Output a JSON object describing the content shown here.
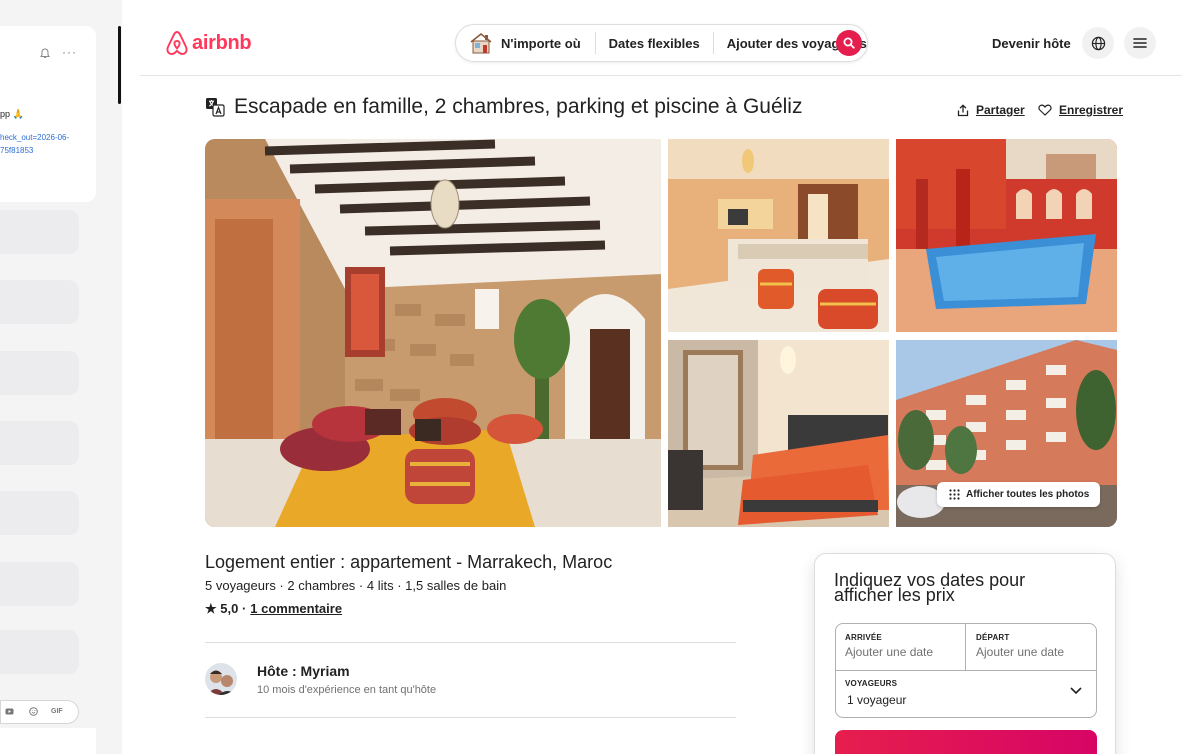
{
  "chat_panel": {
    "app_text": "pp 🙏",
    "link_line1": "heck_out=2026-06-",
    "link_line2": "75f81853",
    "gif_label": "GIF"
  },
  "header": {
    "logo": "airbnb",
    "search": {
      "anywhere": "N'importe où",
      "dates": "Dates flexibles",
      "guests": "Ajouter des voyageurs"
    },
    "become_host": "Devenir hôte"
  },
  "listing": {
    "title": "Escapade en famille, 2 chambres, parking et piscine à Guéliz",
    "share": "Partager",
    "save": "Enregistrer",
    "show_all_photos": "Afficher toutes les photos",
    "type": "Logement entier : appartement - Marrakech, Maroc",
    "details": "5 voyageurs · 2 chambres · 4 lits · 1,5 salles de bain",
    "rating_value": "★ 5,0 ·",
    "review_link": "1 commentaire",
    "host_name": "Hôte : Myriam",
    "host_experience": "10 mois d'expérience en tant qu'hôte"
  },
  "booking": {
    "heading": "Indiquez vos dates pour afficher les prix",
    "checkin_label": "ARRIVÉE",
    "checkin_placeholder": "Ajouter une date",
    "checkout_label": "DÉPART",
    "checkout_placeholder": "Ajouter une date",
    "guests_label": "VOYAGEURS",
    "guests_value": "1 voyageur"
  },
  "colors": {
    "brand": "#ff385c",
    "search_button": "#e61e4d"
  }
}
